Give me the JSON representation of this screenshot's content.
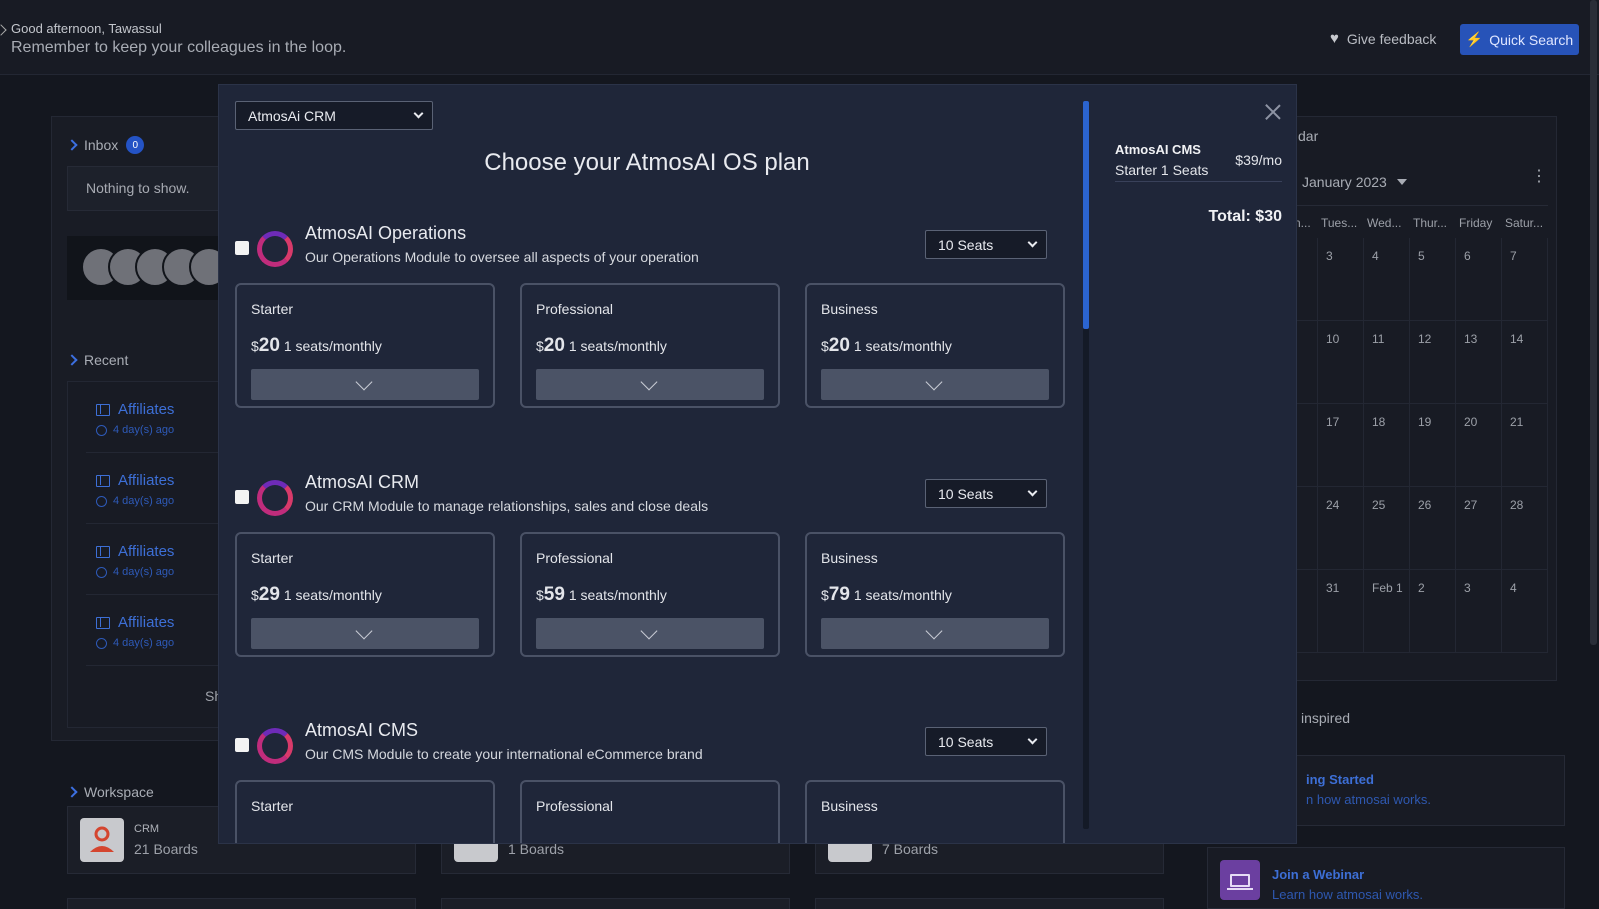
{
  "header": {
    "greeting": "Good afternoon, Tawassul",
    "reminder": "Remember to keep your colleagues in the loop.",
    "feedback_label": "Give feedback",
    "quick_search_label": "Quick Search"
  },
  "inbox": {
    "label": "Inbox",
    "count": "0",
    "empty": "Nothing to show."
  },
  "recent": {
    "label": "Recent",
    "items": [
      {
        "title": "Affiliates",
        "time": "4 day(s) ago"
      },
      {
        "title": "Affiliates",
        "time": "4 day(s) ago"
      },
      {
        "title": "Affiliates",
        "time": "4 day(s) ago"
      },
      {
        "title": "Affiliates",
        "time": "4 day(s) ago"
      }
    ],
    "show_more": "Sh"
  },
  "workspace": {
    "label": "Workspace",
    "cards": [
      {
        "name": "CRM",
        "boards": "21 Boards"
      },
      {
        "name": "",
        "boards": "1 Boards"
      },
      {
        "name": "",
        "boards": "7 Boards"
      }
    ]
  },
  "calendar": {
    "title": "dar",
    "month": "January 2023",
    "day_headers": [
      "n...",
      "Tues...",
      "Wed...",
      "Thur...",
      "Friday",
      "Satur..."
    ],
    "weeks": [
      [
        "",
        "3",
        "4",
        "5",
        "6",
        "7"
      ],
      [
        "",
        "10",
        "11",
        "12",
        "13",
        "14"
      ],
      [
        "",
        "17",
        "18",
        "19",
        "20",
        "21"
      ],
      [
        "",
        "24",
        "25",
        "26",
        "27",
        "28"
      ],
      [
        "",
        "31",
        "Feb 1",
        "2",
        "3",
        "4"
      ]
    ]
  },
  "resources": {
    "heading": "inspired",
    "items": [
      {
        "title": "ing Started",
        "subtitle": "n how atmosai works."
      },
      {
        "title": "Join a Webinar",
        "subtitle": "Learn how atmosai works."
      }
    ]
  },
  "modal": {
    "product_select": "AtmosAi CRM",
    "title": "Choose your AtmosAI OS plan",
    "products": [
      {
        "name": "AtmosAI Operations",
        "description": "Our Operations Module to oversee all aspects of your operation",
        "seats": "10 Seats",
        "tiers": [
          {
            "name": "Starter",
            "price": "20",
            "unit": "1 seats/monthly"
          },
          {
            "name": "Professional",
            "price": "20",
            "unit": "1 seats/monthly"
          },
          {
            "name": "Business",
            "price": "20",
            "unit": "1 seats/monthly"
          }
        ]
      },
      {
        "name": "AtmosAI CRM",
        "description": "Our CRM Module to manage relationships, sales and close deals",
        "seats": "10 Seats",
        "tiers": [
          {
            "name": "Starter",
            "price": "29",
            "unit": "1 seats/monthly"
          },
          {
            "name": "Professional",
            "price": "59",
            "unit": "1 seats/monthly"
          },
          {
            "name": "Business",
            "price": "79",
            "unit": "1 seats/monthly"
          }
        ]
      },
      {
        "name": "AtmosAI CMS",
        "description": "Our CMS Module to create your international eCommerce brand",
        "seats": "10 Seats",
        "tiers": [
          {
            "name": "Starter",
            "price": "",
            "unit": ""
          },
          {
            "name": "Professional",
            "price": "",
            "unit": ""
          },
          {
            "name": "Business",
            "price": "",
            "unit": ""
          }
        ]
      }
    ],
    "currency_symbol": "$",
    "summary": {
      "item_name": "AtmosAI CMS",
      "item_tier": "Starter 1 Seats",
      "item_price": "$39/mo",
      "total": "Total: $30"
    }
  }
}
